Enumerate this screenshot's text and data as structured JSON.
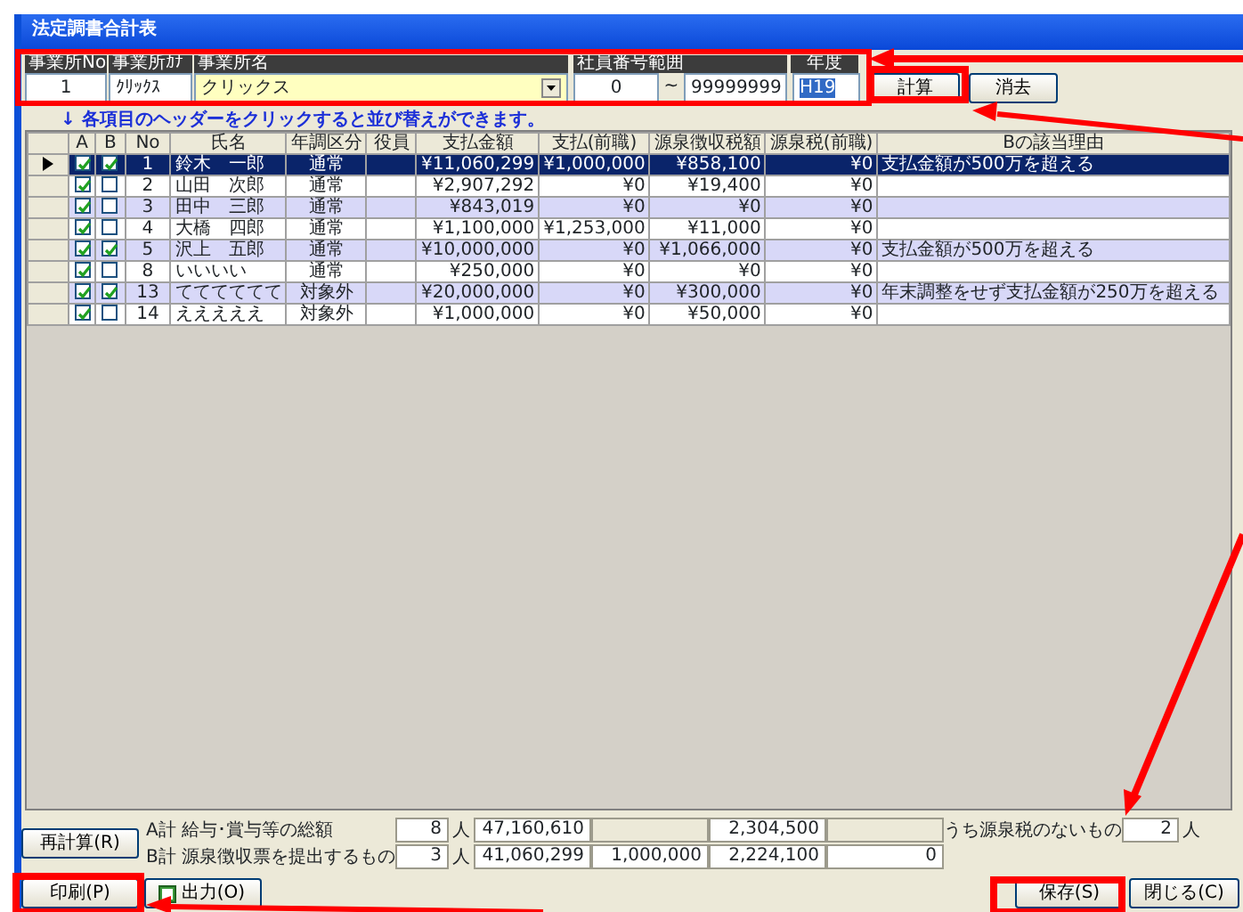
{
  "window": {
    "title": "法定調書合計表"
  },
  "filter": {
    "office_no_label": "事業所No",
    "office_no": "1",
    "office_kana_label": "事業所ｶﾅ",
    "office_kana": "ｸﾘｯｸｽ",
    "office_name_label": "事業所名",
    "office_name": "クリックス",
    "range_label": "社員番号範囲",
    "range_from": "0",
    "range_sep": "~",
    "range_to": "99999999",
    "year_label": "年度",
    "year": "H19"
  },
  "top_buttons": [
    {
      "label": "計算"
    },
    {
      "label": "消去"
    }
  ],
  "hint": "↓ 各項目のヘッダーをクリックすると並び替えができます。",
  "table": {
    "columns": [
      "A",
      "B",
      "No",
      "氏名",
      "年調区分",
      "役員",
      "支払金額",
      "支払(前職)",
      "源泉徴収税額",
      "源泉税(前職)",
      "Bの該当理由"
    ],
    "rows": [
      {
        "selected": true,
        "a": true,
        "b": true,
        "no": "1",
        "name": "鈴木　一郎",
        "category": "通常",
        "paid": "¥11,060,299",
        "paid_prev": "¥1,000,000",
        "withheld": "¥858,100",
        "withheld_prev": "¥0",
        "reason": "支払金額が500万を超える"
      },
      {
        "selected": false,
        "a": true,
        "b": false,
        "no": "2",
        "name": "山田　次郎",
        "category": "通常",
        "paid": "¥2,907,292",
        "paid_prev": "¥0",
        "withheld": "¥19,400",
        "withheld_prev": "¥0"
      },
      {
        "selected": false,
        "a": true,
        "b": false,
        "no": "3",
        "name": "田中　三郎",
        "category": "通常",
        "paid": "¥843,019",
        "paid_prev": "¥0",
        "withheld": "¥0",
        "withheld_prev": "¥0"
      },
      {
        "selected": false,
        "a": true,
        "b": false,
        "no": "4",
        "name": "大橋　四郎",
        "category": "通常",
        "paid": "¥1,100,000",
        "paid_prev": "¥1,253,000",
        "withheld": "¥11,000",
        "withheld_prev": "¥0"
      },
      {
        "selected": false,
        "a": true,
        "b": true,
        "no": "5",
        "name": "沢上　五郎",
        "category": "通常",
        "paid": "¥10,000,000",
        "paid_prev": "¥0",
        "withheld": "¥1,066,000",
        "withheld_prev": "¥0",
        "reason": "支払金額が500万を超える"
      },
      {
        "selected": false,
        "a": true,
        "b": false,
        "no": "8",
        "name": "いいいい",
        "category": "通常",
        "paid": "¥250,000",
        "paid_prev": "¥0",
        "withheld": "¥0",
        "withheld_prev": "¥0"
      },
      {
        "selected": false,
        "a": true,
        "b": true,
        "no": "13",
        "name": "てててててて",
        "category": "対象外",
        "paid": "¥20,000,000",
        "paid_prev": "¥0",
        "withheld": "¥300,000",
        "withheld_prev": "¥0",
        "reason": "年末調整をせず支払金額が250万を超える"
      },
      {
        "selected": false,
        "a": true,
        "b": false,
        "no": "14",
        "name": "えええええ",
        "category": "対象外",
        "paid": "¥1,000,000",
        "paid_prev": "¥0",
        "withheld": "¥50,000",
        "withheld_prev": "¥0"
      }
    ]
  },
  "recalc_button": "再計算(R)",
  "totals": [
    {
      "label": "A計 給与･賞与等の総額",
      "count": "8",
      "unit": "人",
      "paid": "47,160,610",
      "withheld": "2,304,500"
    },
    {
      "label": "B計 源泉徴収票を提出するもの",
      "count": "3",
      "unit": "人",
      "paid": "41,060,299",
      "paid_prev": "1,000,000",
      "withheld": "2,224,100",
      "withheld_prev": "0"
    }
  ],
  "no_tax": {
    "label": "うち源泉税のないもの",
    "count": "2",
    "unit": "人"
  },
  "bottom_left_buttons": [
    {
      "label": "印刷(P)",
      "kind": "plain"
    },
    {
      "label": "出力(O)",
      "kind": "icon"
    }
  ],
  "bottom_right_buttons": [
    {
      "label": "保存(S)"
    },
    {
      "label": "閉じる(C)"
    }
  ]
}
